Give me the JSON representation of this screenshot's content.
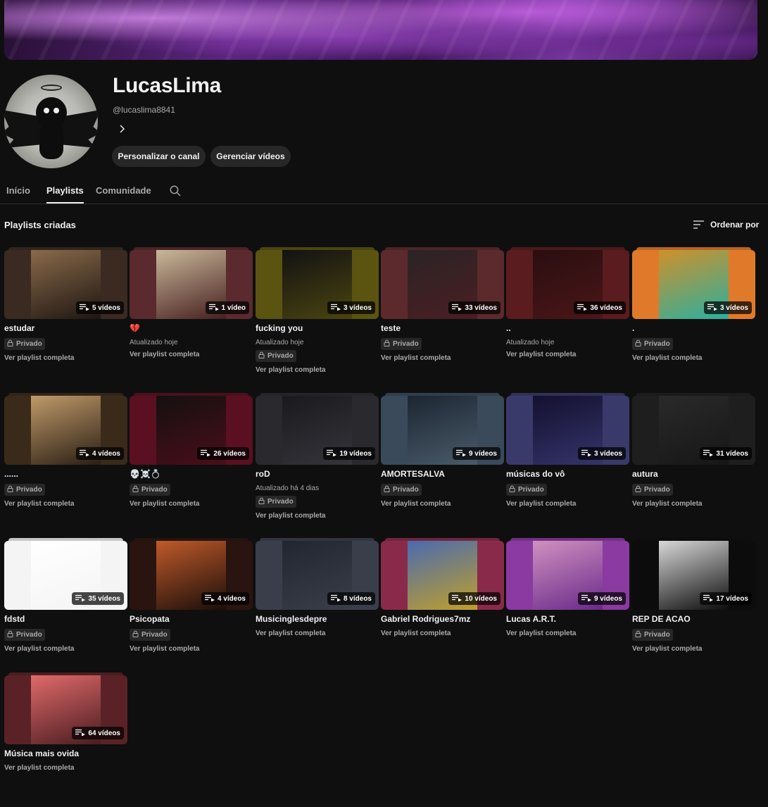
{
  "channel": {
    "name": "LucasLima",
    "handle": "@lucaslima8841",
    "customize_label": "Personalizar o canal",
    "manage_label": "Gerenciar vídeos"
  },
  "tabs": [
    "Início",
    "Playlists",
    "Comunidade"
  ],
  "section": {
    "title": "Playlists criadas",
    "sort_label": "Ordenar por"
  },
  "labels": {
    "private": "Privado",
    "view_full": "Ver playlist completa"
  },
  "playlists": [
    {
      "title": "estudar",
      "count": "5 vídeos",
      "updated": "",
      "private": true,
      "colors": [
        "#3a2a22",
        "#8a6a4a",
        "#1e1612"
      ]
    },
    {
      "title": "💔",
      "count": "1 vídeo",
      "updated": "Atualizado hoje",
      "private": false,
      "colors": [
        "#5a2a2e",
        "#c9b89a",
        "#46201f"
      ]
    },
    {
      "title": "fucking you",
      "count": "3 vídeos",
      "updated": "Atualizado hoje",
      "private": true,
      "colors": [
        "#5a5410",
        "#121212",
        "#4a4410"
      ]
    },
    {
      "title": "teste",
      "count": "33 vídeos",
      "updated": "",
      "private": true,
      "colors": [
        "#5c2a2c",
        "#2b2426",
        "#4a1e22"
      ]
    },
    {
      "title": "..",
      "count": "36 vídeos",
      "updated": "Atualizado hoje",
      "private": false,
      "colors": [
        "#5a1c1e",
        "#2a0e10",
        "#4a1618"
      ]
    },
    {
      "title": ".",
      "count": "3 vídeos",
      "updated": "",
      "private": true,
      "colors": [
        "#e07a2a",
        "#d0902a",
        "#2ab0a0"
      ]
    },
    {
      "title": "......",
      "count": "4 vídeos",
      "updated": "",
      "private": true,
      "colors": [
        "#3a2a1a",
        "#c09a6a",
        "#2a1e14"
      ]
    },
    {
      "title": "💀☠️💍",
      "count": "26 vídeos",
      "updated": "",
      "private": true,
      "colors": [
        "#5a1020",
        "#141010",
        "#4a0e1a"
      ]
    },
    {
      "title": "roD",
      "count": "19 vídeos",
      "updated": "Atualizado há 4 dias",
      "private": true,
      "colors": [
        "#2a2a2e",
        "#1a1a1e",
        "#34343a"
      ]
    },
    {
      "title": "AMORTESALVA",
      "count": "9 vídeos",
      "updated": "",
      "private": true,
      "colors": [
        "#3a4a5a",
        "#1c2632",
        "#4a5a6a"
      ]
    },
    {
      "title": "músicas do vô",
      "count": "3 vídeos",
      "updated": "",
      "private": true,
      "colors": [
        "#3a3a6a",
        "#141030",
        "#34346a"
      ]
    },
    {
      "title": "autura",
      "count": "31 vídeos",
      "updated": "",
      "private": true,
      "colors": [
        "#1e1e1e",
        "#2a2a2a",
        "#161616"
      ]
    },
    {
      "title": "fdstd",
      "count": "35 vídeos",
      "updated": "",
      "private": true,
      "colors": [
        "#f4f4f4",
        "#ffffff",
        "#f4f4f4"
      ]
    },
    {
      "title": "Psicopata",
      "count": "4 vídeos",
      "updated": "",
      "private": true,
      "colors": [
        "#2a1410",
        "#c05a2a",
        "#1a0e0a"
      ]
    },
    {
      "title": "Musicinglesdepre",
      "count": "8 vídeos",
      "updated": "",
      "private": false,
      "colors": [
        "#3a3e4a",
        "#222630",
        "#3a3e4a"
      ]
    },
    {
      "title": "Gabriel Rodrigues7mz",
      "count": "10 vídeos",
      "updated": "",
      "private": false,
      "colors": [
        "#8a2a4a",
        "#4a6ab0",
        "#c0a02a"
      ]
    },
    {
      "title": "Lucas A.R.T.",
      "count": "9 vídeos",
      "updated": "",
      "private": false,
      "colors": [
        "#8a3aa0",
        "#d090c0",
        "#6a2a8a"
      ]
    },
    {
      "title": "REP DE ACAO",
      "count": "17 vídeos",
      "updated": "",
      "private": true,
      "colors": [
        "#0c0c0c",
        "#d8d8d8",
        "#0c0c0c"
      ]
    },
    {
      "title": "Música mais ovida",
      "count": "64 vídeos",
      "updated": "",
      "private": false,
      "colors": [
        "#5a2226",
        "#e06a6a",
        "#4a1c20"
      ]
    }
  ]
}
